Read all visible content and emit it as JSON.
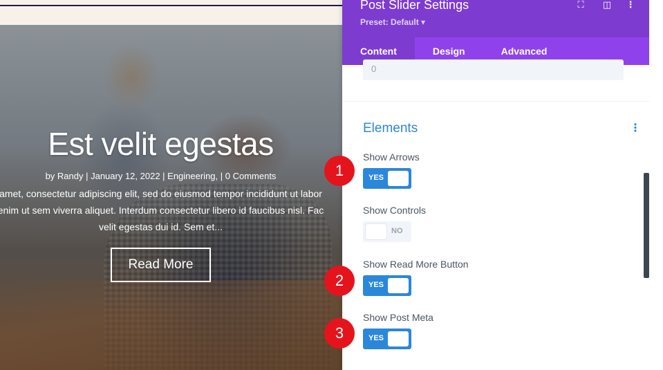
{
  "preview": {
    "post_title": "Est velit egestas",
    "post_meta": "by Randy | January 12, 2022 | Engineering, | 0 Comments",
    "excerpt_lines": [
      "amet, consectetur adipiscing elit, sed do eiusmod tempor incididunt ut labor",
      "enim ut sem viverra aliquet. Interdum consectetur libero id faucibus nisl. Fac",
      "velit egestas dui id. Sem et..."
    ],
    "read_more_label": "Read More"
  },
  "panel": {
    "title": "Post Slider Settings",
    "preset": "Preset: Default ▾",
    "header_icons": [
      "expand-icon",
      "split-view-icon",
      "more-icon"
    ],
    "tabs": [
      {
        "label": "Content",
        "active": true
      },
      {
        "label": "Design",
        "active": false
      },
      {
        "label": "Advanced",
        "active": false
      }
    ],
    "field_stub_value": "0",
    "section_title": "Elements",
    "options": [
      {
        "label": "Show Arrows",
        "state": "YES"
      },
      {
        "label": "Show Controls",
        "state": "NO"
      },
      {
        "label": "Show Read More Button",
        "state": "YES"
      },
      {
        "label": "Show Post Meta",
        "state": "YES"
      }
    ]
  },
  "annotations": [
    "1",
    "2",
    "3"
  ],
  "colors": {
    "header_purple": "#7e3bd0",
    "tab_purple": "#8f42ec",
    "accent_blue": "#2b87da",
    "badge_red": "#e5141c"
  }
}
